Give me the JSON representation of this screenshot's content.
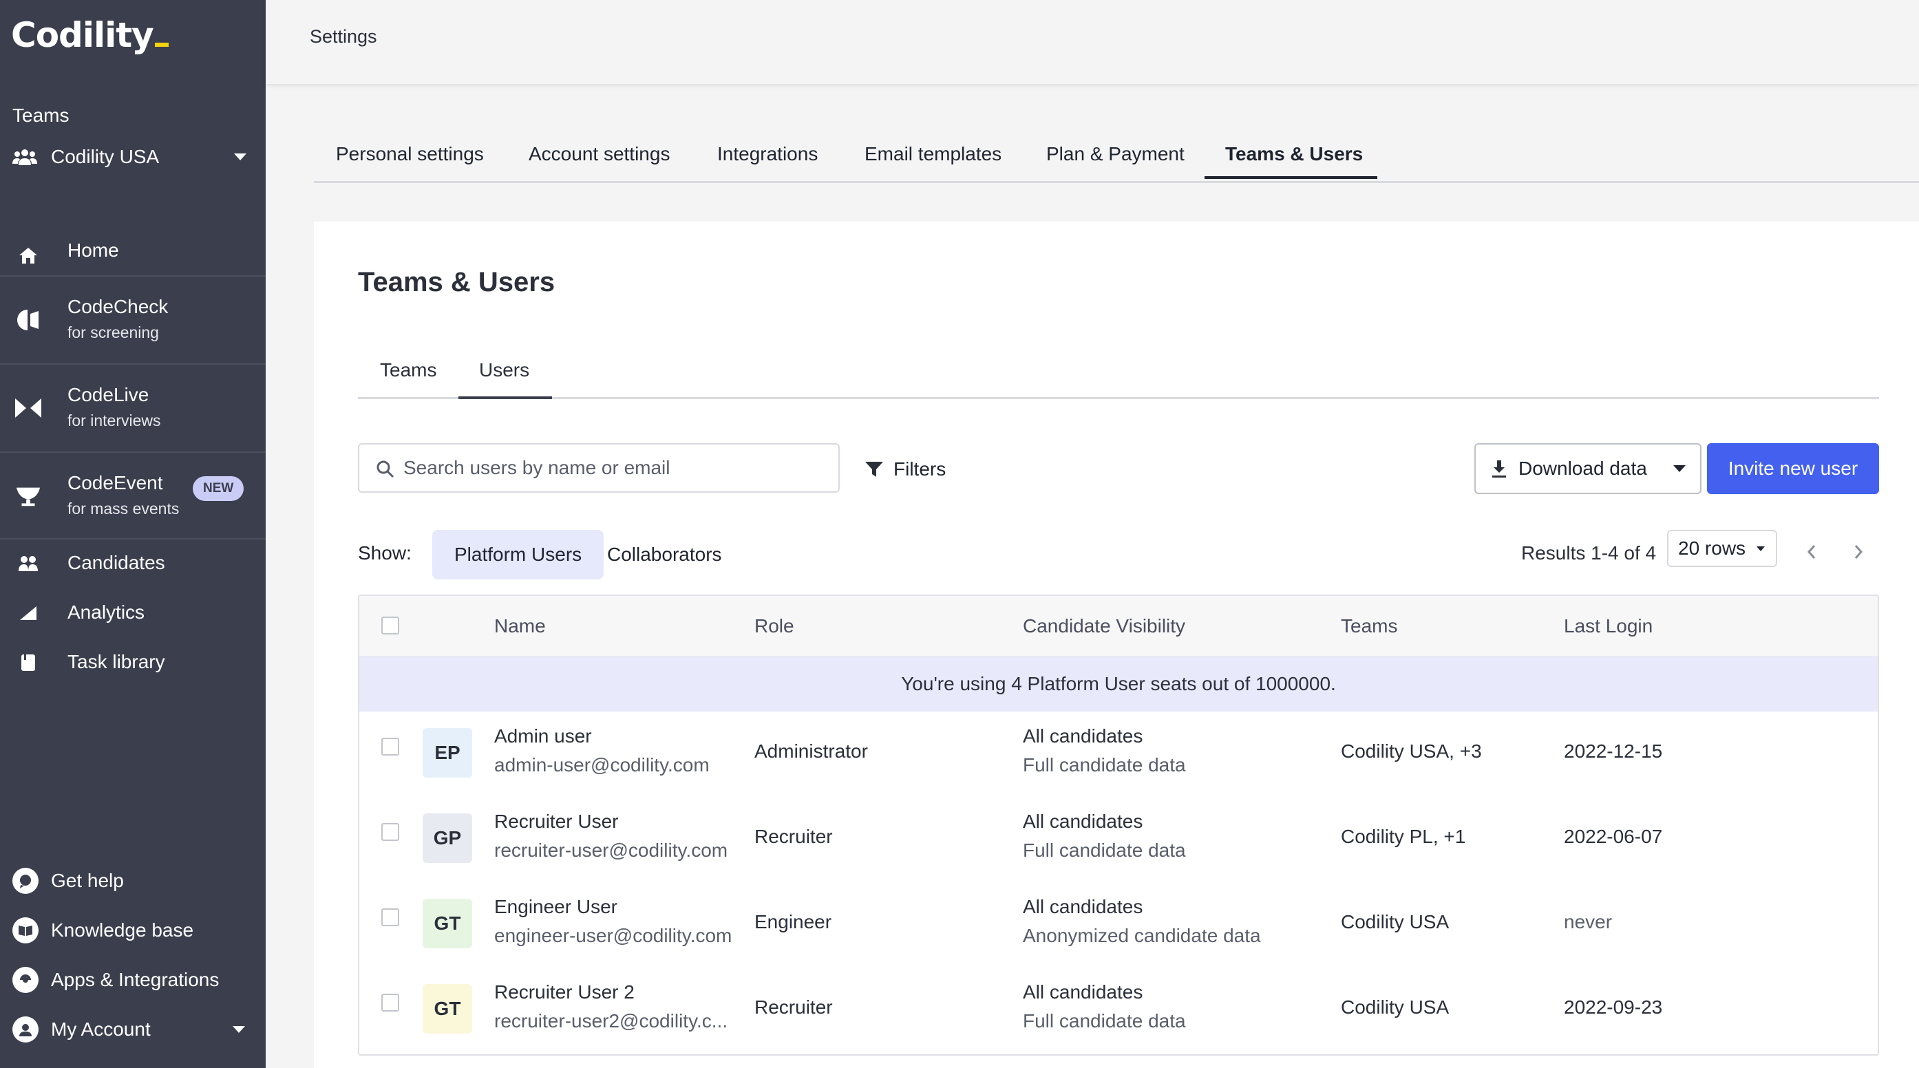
{
  "sidebar": {
    "logo": "Codility",
    "teams_label": "Teams",
    "team_selected": "Codility USA",
    "nav": [
      {
        "label": "Home",
        "sub": ""
      },
      {
        "label": "CodeCheck",
        "sub": "for screening"
      },
      {
        "label": "CodeLive",
        "sub": "for interviews"
      },
      {
        "label": "CodeEvent",
        "sub": "for mass events",
        "badge": "NEW"
      },
      {
        "label": "Candidates",
        "sub": ""
      },
      {
        "label": "Analytics",
        "sub": ""
      },
      {
        "label": "Task library",
        "sub": ""
      }
    ],
    "bottom": [
      {
        "label": "Get help"
      },
      {
        "label": "Knowledge base"
      },
      {
        "label": "Apps & Integrations"
      },
      {
        "label": "My Account"
      }
    ]
  },
  "header": {
    "breadcrumb": "Settings"
  },
  "settings_tabs": [
    {
      "label": "Personal settings"
    },
    {
      "label": "Account settings"
    },
    {
      "label": "Integrations"
    },
    {
      "label": "Email templates"
    },
    {
      "label": "Plan & Payment"
    },
    {
      "label": "Teams & Users",
      "active": true
    }
  ],
  "main": {
    "title": "Teams & Users",
    "subtabs": [
      {
        "label": "Teams"
      },
      {
        "label": "Users",
        "active": true
      }
    ],
    "search": {
      "placeholder": "Search users by name or email",
      "value": ""
    },
    "filters_label": "Filters",
    "download_label": "Download data",
    "invite_label": "Invite new user",
    "show_label": "Show:",
    "pills": [
      {
        "label": "Platform Users",
        "active": true
      },
      {
        "label": "Collaborators"
      }
    ],
    "results_text": "Results 1-4 of 4",
    "rows_select": "20 rows",
    "accent_color": "#4361ee"
  },
  "table": {
    "columns": [
      "Name",
      "Role",
      "Candidate Visibility",
      "Teams",
      "Last Login"
    ],
    "seats_banner": "You're using 4 Platform User seats out of 1000000.",
    "rows": [
      {
        "initials": "EP",
        "avatar_color": "#e6f0fb",
        "name": "Admin user",
        "email": "admin-user@codility.com",
        "role": "Administrator",
        "visibility": "All candidates",
        "visibility_detail": "Full candidate data",
        "teams": "Codility USA, +3",
        "last_login": "2022-12-15"
      },
      {
        "initials": "GP",
        "avatar_color": "#e8eaf2",
        "name": "Recruiter User",
        "email": "recruiter-user@codility.com",
        "role": "Recruiter",
        "visibility": "All candidates",
        "visibility_detail": "Full candidate data",
        "teams": "Codility PL, +1",
        "last_login": "2022-06-07"
      },
      {
        "initials": "GT",
        "avatar_color": "#e6f5e1",
        "name": "Engineer User",
        "email": "engineer-user@codility.com",
        "role": "Engineer",
        "visibility": "All candidates",
        "visibility_detail": "Anonymized candidate data",
        "teams": "Codility USA",
        "last_login": "never"
      },
      {
        "initials": "GT",
        "avatar_color": "#fbf8d9",
        "name": "Recruiter User 2",
        "email": "recruiter-user2@codility.c...",
        "role": "Recruiter",
        "visibility": "All candidates",
        "visibility_detail": "Full candidate data",
        "teams": "Codility USA",
        "last_login": "2022-09-23"
      }
    ]
  }
}
